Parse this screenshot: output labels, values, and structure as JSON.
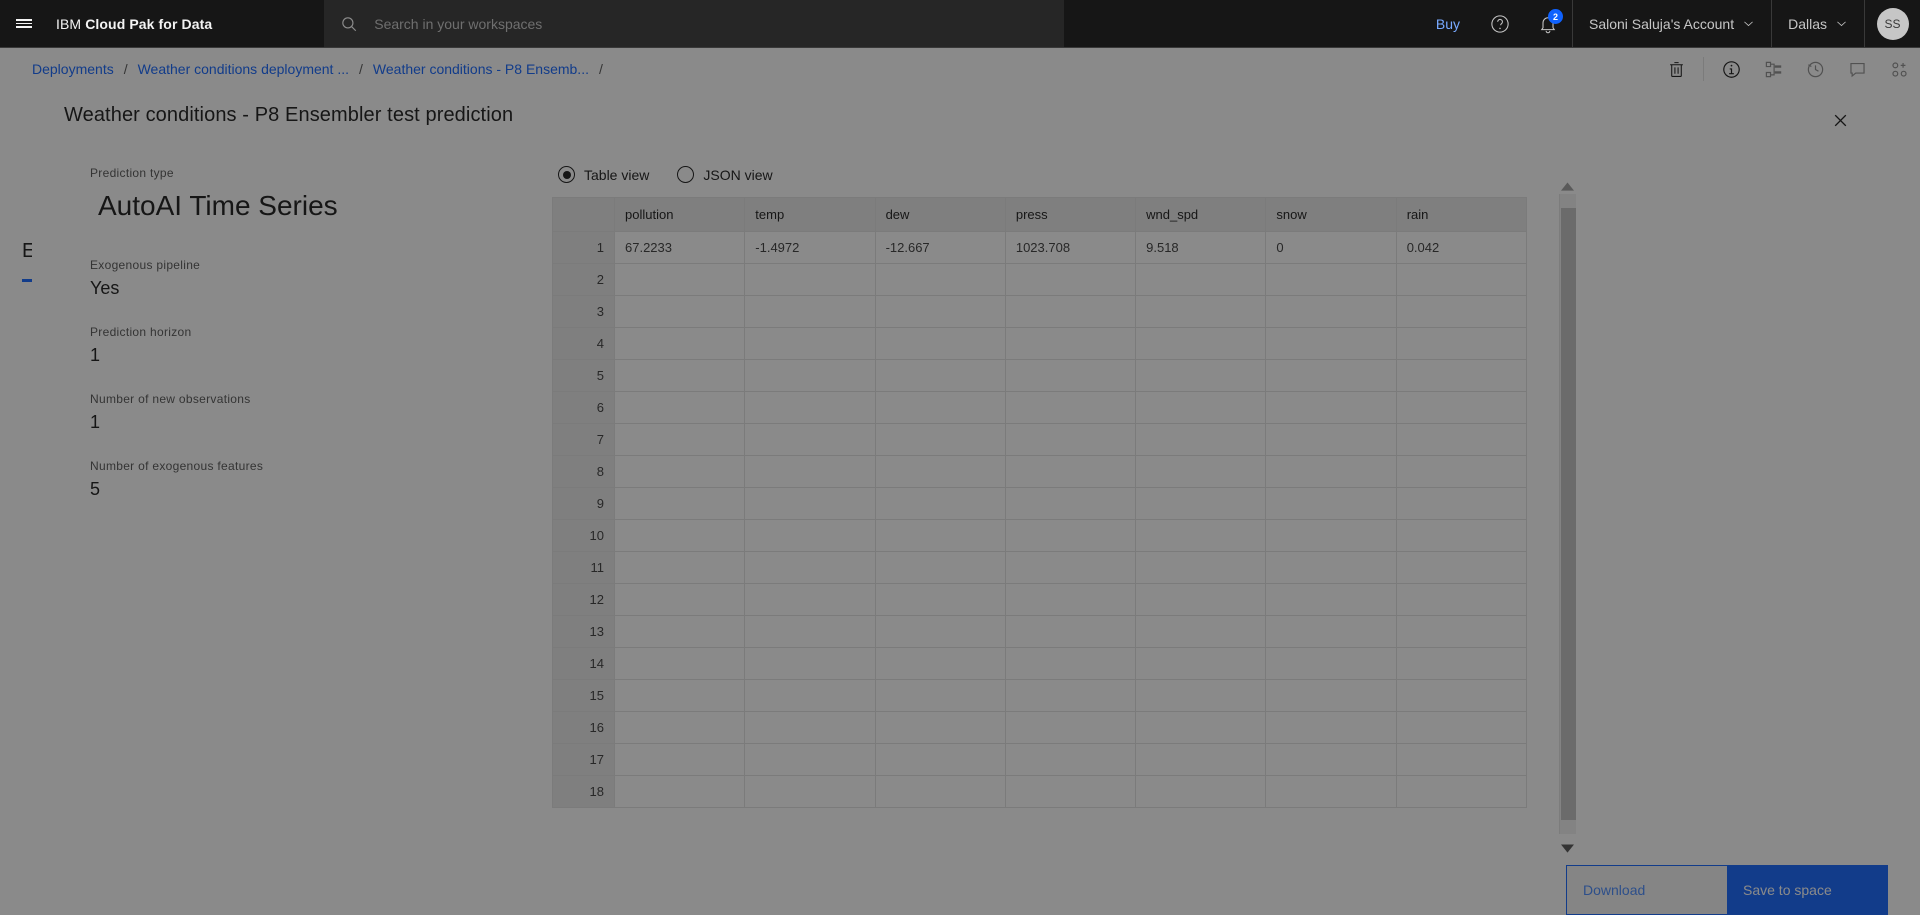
{
  "header": {
    "menu_icon": "hamburger-icon",
    "brand_prefix": "IBM ",
    "brand_bold": "Cloud Pak for Data",
    "search": {
      "placeholder": "Search in your workspaces",
      "value": "",
      "icon": "search-icon"
    },
    "buy_label": "Buy",
    "help_icon": "help-icon",
    "notifications_icon": "bell-icon",
    "notification_count": "2",
    "account_label": "Saloni Saluja's Account",
    "region_label": "Dallas",
    "avatar_initials": "SS"
  },
  "breadcrumb": {
    "items": [
      {
        "label": "Deployments"
      },
      {
        "label": "Weather conditions deployment ..."
      },
      {
        "label": "Weather conditions - P8 Ensemb..."
      }
    ],
    "separator": "/",
    "actions": [
      {
        "icon": "trash-icon"
      },
      {
        "icon": "info-icon"
      },
      {
        "icon": "hierarchy-icon"
      },
      {
        "icon": "history-icon"
      },
      {
        "icon": "comment-icon"
      },
      {
        "icon": "manage-icon"
      }
    ]
  },
  "background": {
    "partial_heading": "E"
  },
  "modal": {
    "title": "Weather conditions - P8 Ensembler test prediction",
    "close_icon": "close-icon",
    "info": [
      {
        "label": "Prediction type",
        "value": "AutoAI Time Series",
        "big": true
      },
      {
        "label": "Exogenous pipeline",
        "value": "Yes"
      },
      {
        "label": "Prediction horizon",
        "value": "1"
      },
      {
        "label": "Number of new observations",
        "value": "1"
      },
      {
        "label": "Number of exogenous features",
        "value": "5"
      }
    ],
    "view_options": [
      {
        "label": "Table view",
        "selected": true
      },
      {
        "label": "JSON view",
        "selected": false
      }
    ],
    "table": {
      "columns": [
        "",
        "pollution",
        "temp",
        "dew",
        "press",
        "wnd_spd",
        "snow",
        "rain"
      ],
      "rows": [
        {
          "index": "1",
          "cells": [
            "67.2233",
            "-1.4972",
            "-12.667",
            "1023.708",
            "9.518",
            "0",
            "0.042"
          ]
        },
        {
          "index": "2",
          "cells": [
            "",
            "",
            "",
            "",
            "",
            "",
            ""
          ]
        },
        {
          "index": "3",
          "cells": [
            "",
            "",
            "",
            "",
            "",
            "",
            ""
          ]
        },
        {
          "index": "4",
          "cells": [
            "",
            "",
            "",
            "",
            "",
            "",
            ""
          ]
        },
        {
          "index": "5",
          "cells": [
            "",
            "",
            "",
            "",
            "",
            "",
            ""
          ]
        },
        {
          "index": "6",
          "cells": [
            "",
            "",
            "",
            "",
            "",
            "",
            ""
          ]
        },
        {
          "index": "7",
          "cells": [
            "",
            "",
            "",
            "",
            "",
            "",
            ""
          ]
        },
        {
          "index": "8",
          "cells": [
            "",
            "",
            "",
            "",
            "",
            "",
            ""
          ]
        },
        {
          "index": "9",
          "cells": [
            "",
            "",
            "",
            "",
            "",
            "",
            ""
          ]
        },
        {
          "index": "10",
          "cells": [
            "",
            "",
            "",
            "",
            "",
            "",
            ""
          ]
        },
        {
          "index": "11",
          "cells": [
            "",
            "",
            "",
            "",
            "",
            "",
            ""
          ]
        },
        {
          "index": "12",
          "cells": [
            "",
            "",
            "",
            "",
            "",
            "",
            ""
          ]
        },
        {
          "index": "13",
          "cells": [
            "",
            "",
            "",
            "",
            "",
            "",
            ""
          ]
        },
        {
          "index": "14",
          "cells": [
            "",
            "",
            "",
            "",
            "",
            "",
            ""
          ]
        },
        {
          "index": "15",
          "cells": [
            "",
            "",
            "",
            "",
            "",
            "",
            ""
          ]
        },
        {
          "index": "16",
          "cells": [
            "",
            "",
            "",
            "",
            "",
            "",
            ""
          ]
        },
        {
          "index": "17",
          "cells": [
            "",
            "",
            "",
            "",
            "",
            "",
            ""
          ]
        },
        {
          "index": "18",
          "cells": [
            "",
            "",
            "",
            "",
            "",
            "",
            ""
          ]
        }
      ]
    },
    "footer": {
      "download_label": "Download",
      "save_label": "Save to space"
    }
  },
  "colors": {
    "brand_blue": "#0f62fe",
    "link_blue": "#4589ff",
    "header_bg": "#161616",
    "modal_bg": "#ffffff"
  }
}
